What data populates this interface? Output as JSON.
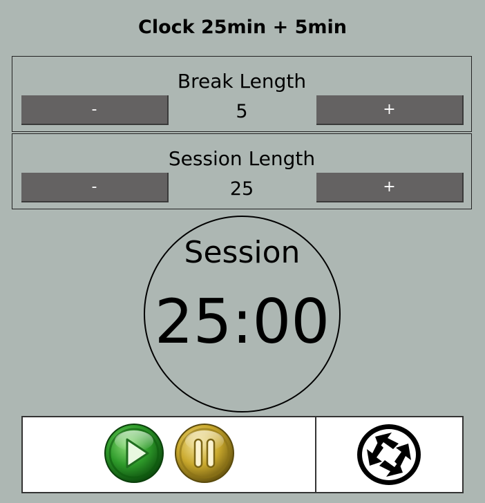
{
  "title": "Clock 25min + 5min",
  "break": {
    "label": "Break Length",
    "value": "5",
    "decrement_label": "-",
    "increment_label": "+"
  },
  "session": {
    "label": "Session Length",
    "value": "25",
    "decrement_label": "-",
    "increment_label": "+"
  },
  "timer": {
    "label": "Session",
    "time": "25:00"
  },
  "controls": {
    "play_icon": "play-icon",
    "pause_icon": "pause-icon",
    "reset_icon": "reset-icon"
  },
  "colors": {
    "background": "#adb7b3",
    "button": "#646262",
    "play_green": "#2e9a2a",
    "pause_gold": "#c9a82c"
  }
}
